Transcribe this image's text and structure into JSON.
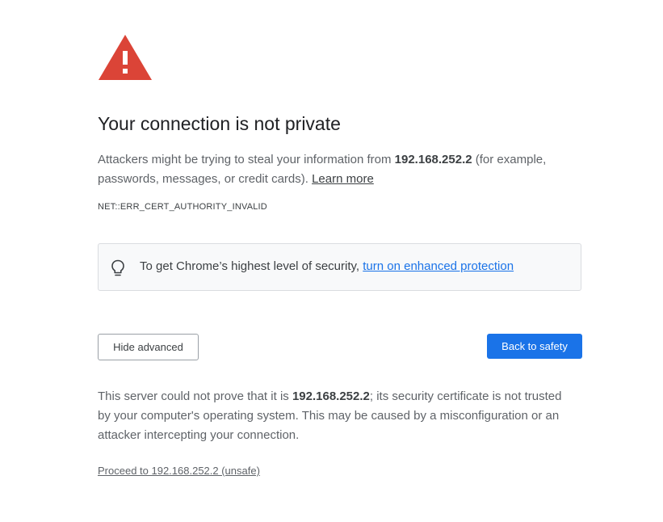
{
  "warning": {
    "icon": "warning-triangle-icon",
    "color": "#db4437"
  },
  "title": "Your connection is not private",
  "explanation": {
    "prefix": "Attackers might be trying to steal your information from ",
    "host": "192.168.252.2",
    "suffix": " (for example, passwords, messages, or credit cards). ",
    "learn_more": "Learn more"
  },
  "error_code": "NET::ERR_CERT_AUTHORITY_INVALID",
  "enhanced_protection": {
    "icon": "lightbulb-icon",
    "text": "To get Chrome’s highest level of security, ",
    "link": "turn on enhanced protection"
  },
  "buttons": {
    "hide_advanced": "Hide advanced",
    "back_to_safety": "Back to safety"
  },
  "details": {
    "prefix": "This server could not prove that it is ",
    "host": "192.168.252.2",
    "suffix": "; its security certificate is not trusted by your computer's operating system. This may be caused by a misconfiguration or an attacker intercepting your connection."
  },
  "proceed_link": "Proceed to 192.168.252.2 (unsafe)",
  "colors": {
    "primary_button": "#1a73e8",
    "link": "#1a73e8",
    "body_text": "#5f6368",
    "heading": "#202124"
  }
}
